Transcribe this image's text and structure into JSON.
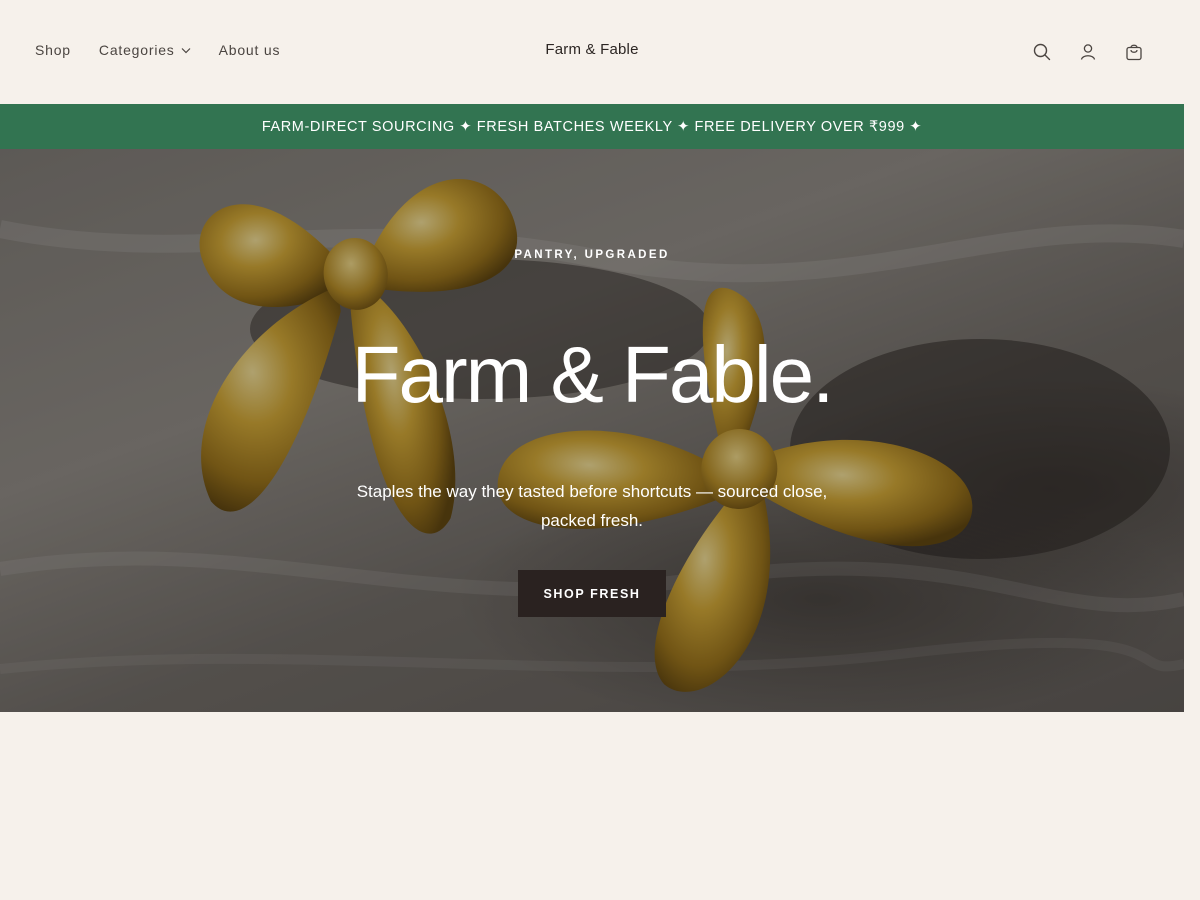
{
  "header": {
    "nav": {
      "shop": "Shop",
      "categories": "Categories",
      "about": "About us"
    },
    "brand": "Farm & Fable",
    "icons": [
      "search-icon",
      "account-icon",
      "cart-icon"
    ]
  },
  "announcement": {
    "text": "FARM-DIRECT SOURCING ✦ FRESH BATCHES WEEKLY ✦ FREE DELIVERY OVER ₹999 ✦"
  },
  "hero": {
    "eyebrow": "PANTRY, UPGRADED",
    "title": "Farm & Fable.",
    "subtitle": "Staples the way they tasted before shortcuts — sourced close, packed fresh.",
    "cta": "SHOP FRESH"
  },
  "colors": {
    "background": "#f6f1eb",
    "announcement_bg": "#327451",
    "cta_bg": "#2a2220",
    "text": "#2c2623"
  }
}
